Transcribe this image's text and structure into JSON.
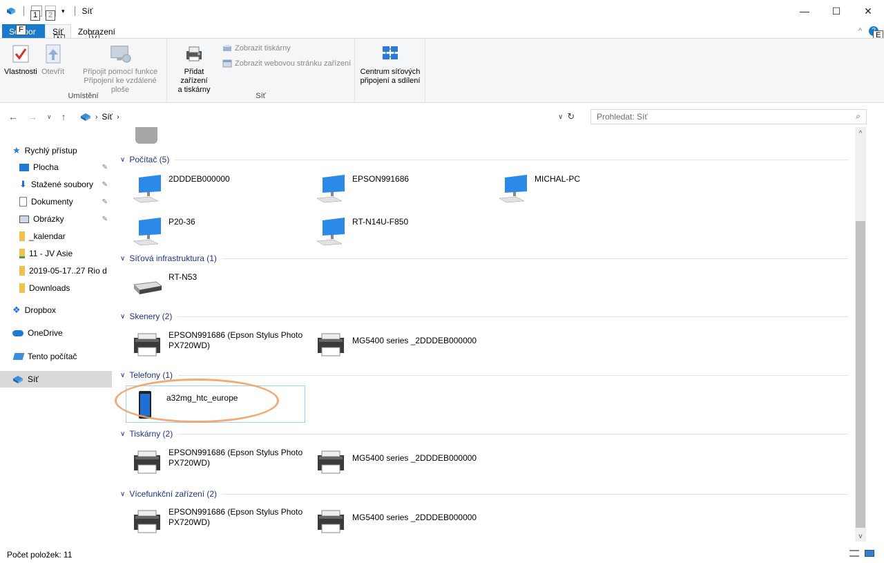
{
  "window": {
    "title": "Síť",
    "keytips": {
      "qat1": "1",
      "qat2": "2",
      "file": "F",
      "sit": "N",
      "zobrazeni": "V",
      "help": "E"
    },
    "controls": {
      "minimize": "—",
      "maximize": "☐",
      "close": "✕"
    }
  },
  "tabs": [
    {
      "label": "Soubor"
    },
    {
      "label": "Síť"
    },
    {
      "label": "Zobrazení"
    }
  ],
  "ribbon": {
    "groups": {
      "umisteni": "Umístění",
      "sit": "Síť"
    },
    "buttons": {
      "vlastnosti": "Vlastnosti",
      "otevrit": "Otevřít",
      "pripojit_line1": "Připojit pomocí funkce",
      "pripojit_line2": "Připojení ke vzdálené ploše",
      "pridat_line1": "Přidat zařízení",
      "pridat_line2": "a tiskárny",
      "zobrazit_tiskarny": "Zobrazit tiskárny",
      "zobrazit_web": "Zobrazit webovou stránku zařízení",
      "centrum_line1": "Centrum síťových",
      "centrum_line2": "připojení a sdílení"
    }
  },
  "address": {
    "path": "Síť",
    "search_placeholder": "Prohledat: Síť"
  },
  "sidebar": {
    "quick_access": "Rychlý přístup",
    "items": [
      {
        "label": "Plocha",
        "pinned": true
      },
      {
        "label": "Stažené soubory",
        "pinned": true
      },
      {
        "label": "Dokumenty",
        "pinned": true
      },
      {
        "label": "Obrázky",
        "pinned": true
      },
      {
        "label": "_kalendar",
        "pinned": false
      },
      {
        "label": "11 - JV Asie",
        "pinned": false
      },
      {
        "label": "2019-05-17..27 Rio d",
        "pinned": false
      },
      {
        "label": "Downloads",
        "pinned": false
      }
    ],
    "dropbox": "Dropbox",
    "onedrive": "OneDrive",
    "this_pc": "Tento počítač",
    "network": "Síť"
  },
  "groups": [
    {
      "title": "Počítač (5)",
      "items": [
        "2DDDEB000000",
        "EPSON991686",
        "MICHAL-PC",
        "P20-36",
        "RT-N14U-F850"
      ]
    },
    {
      "title": "Síťová infrastruktura (1)",
      "items": [
        "RT-N53"
      ]
    },
    {
      "title": "Skenery (2)",
      "items": [
        "EPSON991686 (Epson Stylus Photo PX720WD)",
        "MG5400 series _2DDDEB000000"
      ]
    },
    {
      "title": "Telefony (1)",
      "items": [
        "a32mg_htc_europe"
      ]
    },
    {
      "title": "Tiskárny (2)",
      "items": [
        "EPSON991686 (Epson Stylus Photo PX720WD)",
        "MG5400 series _2DDDEB000000"
      ]
    },
    {
      "title": "Vícefunkční zařízení (2)",
      "items": [
        "EPSON991686 (Epson Stylus Photo PX720WD)",
        "MG5400 series _2DDDEB000000"
      ]
    }
  ],
  "status": {
    "count": "Počet položek: 11"
  },
  "colors": {
    "accent": "#1979ca",
    "group_header": "#1e3287",
    "selection": "#d9d9d9",
    "highlight": "#f3a165"
  }
}
